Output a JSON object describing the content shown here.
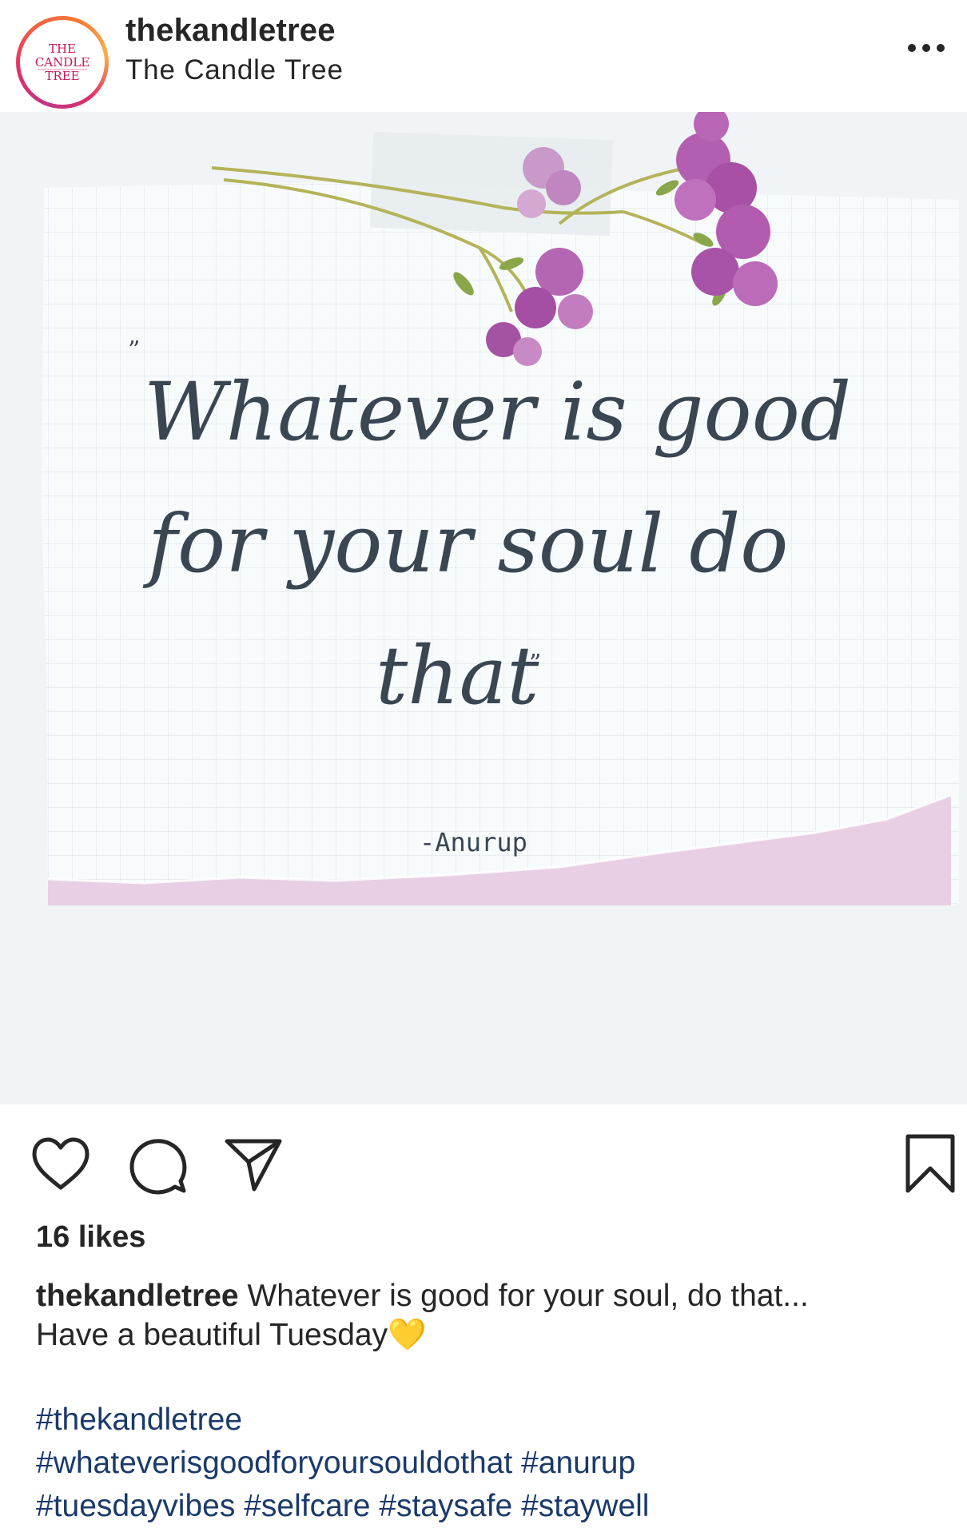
{
  "header": {
    "username": "thekandletree",
    "subtitle": "The Candle Tree",
    "avatar_text_lines": [
      "THE",
      "CANDLE",
      "TREE"
    ],
    "more_icon": "more-horizontal-icon"
  },
  "post": {
    "quote_lines": [
      "Whatever is good",
      "for your soul do",
      "that"
    ],
    "quote_author": "-Anurup",
    "image_icon": "pressed-flowers"
  },
  "actions": {
    "like_icon": "heart-icon",
    "comment_icon": "comment-icon",
    "share_icon": "send-icon",
    "save_icon": "bookmark-icon"
  },
  "likes": "16 likes",
  "caption": {
    "username": "thekandletree",
    "line1": "Whatever is good for your soul, do that...",
    "line2": "Have a beautiful Tuesday",
    "emoji": "💛"
  },
  "hashtags": [
    "#thekandletree",
    "#whateverisgoodforyoursouldothat",
    "#anurup",
    "#tuesdayvibes",
    "#selfcare",
    "#staysafe",
    "#staywell"
  ],
  "colors": {
    "text": "#262626",
    "hashtag": "#1a3a6b",
    "brand_pink": "#c2185b",
    "paper": "#f7fafc",
    "paper_strip": "#e8cfe3",
    "ink": "#3a4652"
  }
}
